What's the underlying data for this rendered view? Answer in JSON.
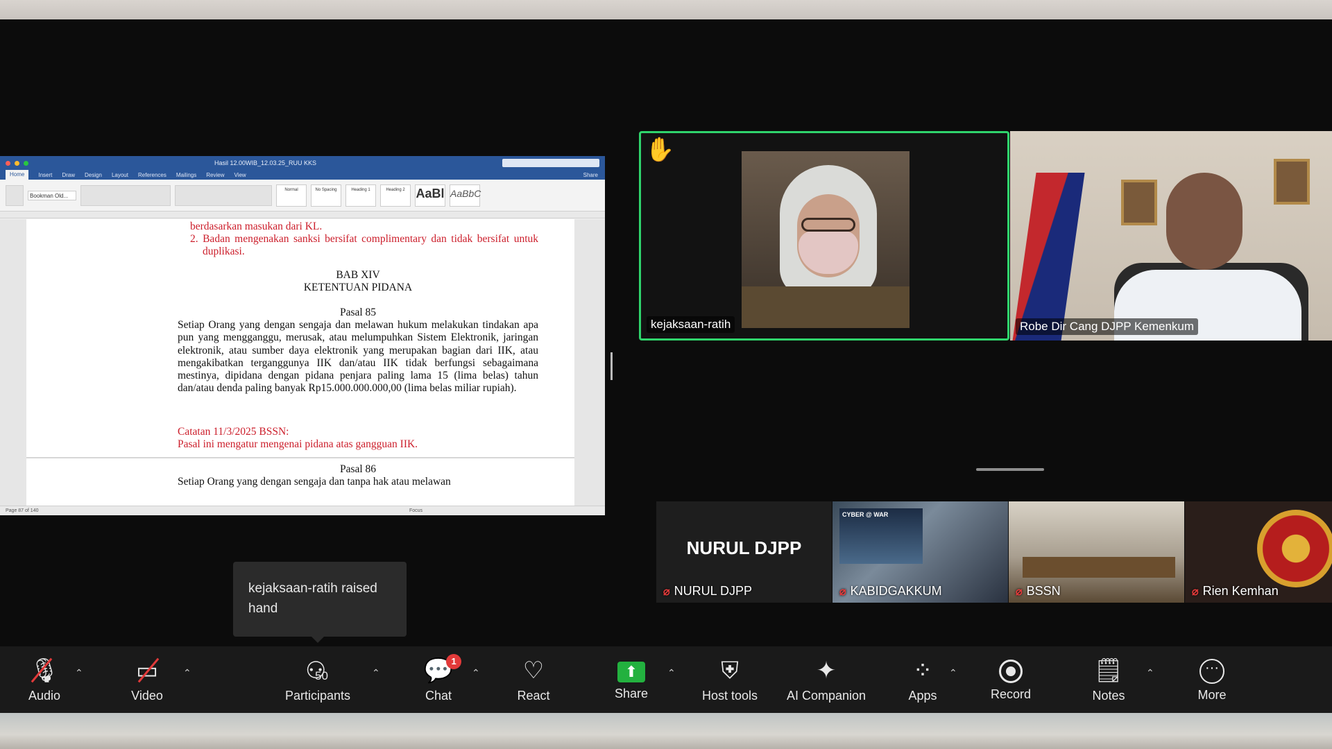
{
  "document": {
    "window_title": "Hasil 12.00WIB_12.03.25_RUU KKS",
    "ribbon_tabs": [
      "Home",
      "Insert",
      "Draw",
      "Design",
      "Layout",
      "References",
      "Mailings",
      "Review",
      "View"
    ],
    "share_label": "Share",
    "font_name": "Bookman Old...",
    "styles": [
      "Normal",
      "No Spacing",
      "Heading 1",
      "Heading 2",
      "AaBl",
      "AaBbC"
    ],
    "lines": {
      "l1": "berdasarkan masukan dari KL.",
      "l2": "2. Badan mengenakan sanksi bersifat complimentary dan tidak bersifat untuk duplikasi.",
      "bab": "BAB XIV",
      "ketentuan": "KETENTUAN PIDANA",
      "pasal85": "Pasal 85",
      "pasal85_body": "Setiap Orang yang dengan sengaja dan melawan hukum melakukan tindakan apa pun yang mengganggu, merusak, atau melumpuhkan Sistem Elektronik, jaringan elektronik, atau sumber daya elektronik yang merupakan bagian dari IIK, atau mengakibatkan terganggunya IIK dan/atau IIK tidak berfungsi sebagaimana mestinya, dipidana dengan pidana penjara paling lama 15 (lima belas) tahun dan/atau denda paling banyak Rp15.000.000.000,00 (lima belas miliar rupiah).",
      "catatan": "Catatan 11/3/2025 BSSN:",
      "catatan_body": "Pasal ini mengatur mengenai pidana atas gangguan IIK.",
      "pasal86": "Pasal 86",
      "pasal86_body": "Setiap Orang yang dengan sengaja dan tanpa hak atau melawan"
    },
    "status_left": "Page 87 of 140",
    "status_words": "Focus"
  },
  "videos": {
    "ratih": "kejaksaan-ratih",
    "robe": "Robe Dir Cang DJPP Kemenkum"
  },
  "thumbnails": [
    {
      "display_name": "NURUL DJPP",
      "label": "NURUL DJPP"
    },
    {
      "label": "KABIDGAKKUM",
      "card_text": "CYBER @ WAR"
    },
    {
      "label": "BSSN"
    },
    {
      "label": "Rien Kemhan"
    }
  ],
  "toast": "kejaksaan-ratih raised hand",
  "toolbar": {
    "audio": "Audio",
    "video": "Video",
    "participants": "Participants",
    "participants_count": "50",
    "chat": "Chat",
    "chat_badge": "1",
    "react": "React",
    "share": "Share",
    "host_tools": "Host tools",
    "ai_companion": "AI Companion",
    "apps": "Apps",
    "record": "Record",
    "notes": "Notes",
    "more": "More"
  },
  "colors": {
    "active_speaker_border": "#2fd46c",
    "share_green": "#23b13f",
    "alert_red": "#e23a3a",
    "word_blue": "#2b579a"
  },
  "icons": [
    "hand-raised-icon",
    "mic-muted-icon",
    "video-off-icon",
    "participants-icon",
    "chat-icon",
    "heart-icon",
    "share-screen-icon",
    "shield-icon",
    "sparkle-icon",
    "apps-icon",
    "record-icon",
    "notes-icon",
    "more-icon"
  ]
}
